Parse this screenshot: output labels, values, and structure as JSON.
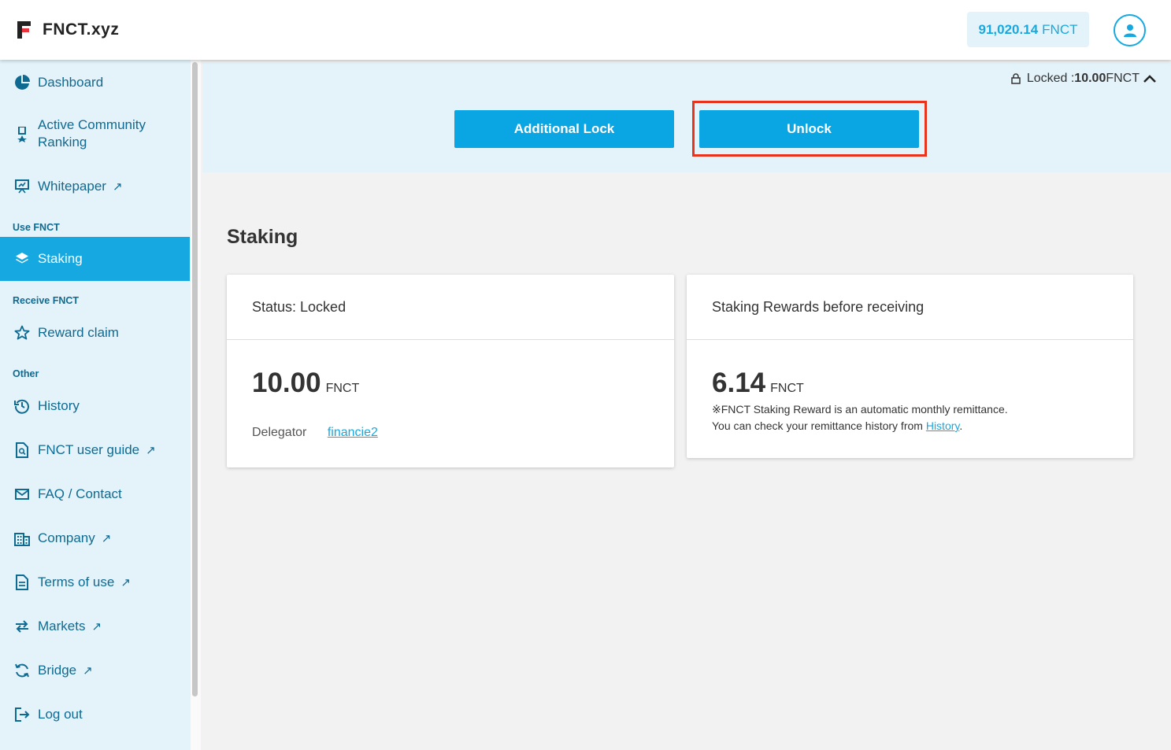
{
  "header": {
    "logo_text": "FNCT.xyz",
    "balance_value": "91,020.14",
    "balance_unit": "FNCT"
  },
  "sidebar": {
    "items": [
      {
        "label": "Dashboard",
        "icon": "pie-chart-icon"
      },
      {
        "label_line1": "Active Community",
        "label_line2": "Ranking",
        "icon": "medal-icon"
      },
      {
        "label": "Whitepaper",
        "icon": "presentation-icon",
        "external": "↗"
      },
      {
        "label": "Staking",
        "icon": "layers-icon"
      },
      {
        "label": "Reward claim",
        "icon": "star-icon"
      },
      {
        "label": "History",
        "icon": "history-icon"
      },
      {
        "label": "FNCT user guide",
        "icon": "document-search-icon",
        "external": "↗"
      },
      {
        "label": "FAQ / Contact",
        "icon": "mail-icon"
      },
      {
        "label": "Company",
        "icon": "building-icon",
        "external": "↗"
      },
      {
        "label": "Terms of use",
        "icon": "document-icon",
        "external": "↗"
      },
      {
        "label": "Markets",
        "icon": "swap-icon",
        "external": "↗"
      },
      {
        "label": "Bridge",
        "icon": "refresh-icon",
        "external": "↗"
      },
      {
        "label": "Log out",
        "icon": "logout-icon"
      }
    ],
    "sections": {
      "use": "Use FNCT",
      "receive": "Receive FNCT",
      "other": "Other"
    }
  },
  "lock_panel": {
    "locked_label": "Locked : ",
    "locked_value": "10.00",
    "locked_unit": "FNCT",
    "additional_lock_label": "Additional Lock",
    "unlock_label": "Unlock"
  },
  "main": {
    "title": "Staking",
    "status_card": {
      "heading": "Status: Locked",
      "amount": "10.00",
      "unit": "FNCT",
      "delegator_label": "Delegator",
      "delegator_value": "financie2"
    },
    "rewards_card": {
      "heading": "Staking Rewards before receiving",
      "amount": "6.14",
      "unit": "FNCT",
      "note_line1": "※FNCT Staking Reward is an automatic monthly remittance.",
      "note_line2_prefix": "You can check your remittance history from ",
      "note_link": "History",
      "note_line2_suffix": "."
    }
  },
  "colors": {
    "accent": "#16a9e1",
    "sidebar_bg": "#e4f3fa",
    "highlight": "#e8341c"
  }
}
